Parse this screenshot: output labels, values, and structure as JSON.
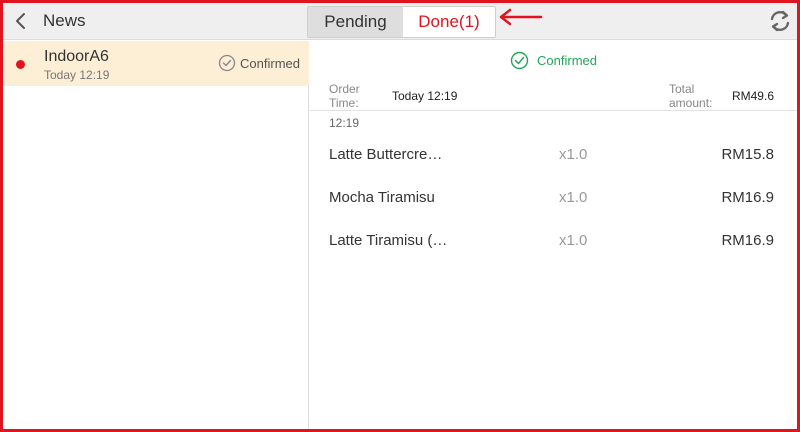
{
  "header": {
    "title": "News",
    "tabs": [
      {
        "label": "Pending"
      },
      {
        "label": "Done(1)"
      }
    ],
    "back_icon": "chevron-left-icon",
    "refresh_icon": "refresh-icon"
  },
  "colors": {
    "accent_red": "#e0141e",
    "confirmed_green": "#24a55a",
    "selected_row": "#fdeed6"
  },
  "orders": [
    {
      "name": "IndoorA6",
      "time": "Today 12:19",
      "status": "Confirmed"
    }
  ],
  "detail": {
    "status": "Confirmed",
    "order_time_label": "Order Time:",
    "order_time_value": "Today 12:19",
    "order_time_cont": "12:19",
    "total_label": "Total amount:",
    "total_value": "RM49.6",
    "items": [
      {
        "name": "Latte Buttercre…",
        "qty": "x1.0",
        "price": "RM15.8"
      },
      {
        "name": "Mocha Tiramisu",
        "qty": "x1.0",
        "price": "RM16.9"
      },
      {
        "name": "Latte Tiramisu (…",
        "qty": "x1.0",
        "price": "RM16.9"
      }
    ]
  }
}
